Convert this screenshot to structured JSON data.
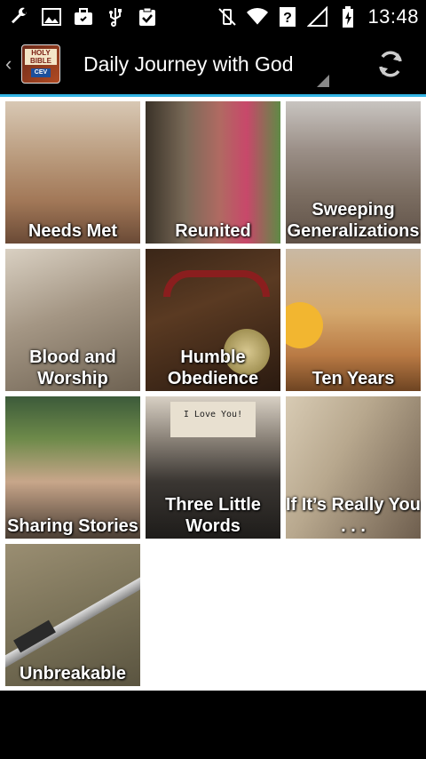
{
  "status_bar": {
    "time": "13:48",
    "left_icons": [
      "wrench-icon",
      "image-icon",
      "briefcase-icon",
      "usb-icon",
      "clipboard-check-icon"
    ],
    "right_icons": [
      "vibrate-off-icon",
      "wifi-icon",
      "question-mark-icon",
      "signal-icon",
      "battery-charging-icon"
    ]
  },
  "action_bar": {
    "title": "Daily Journey with God",
    "logo_text_top": "HOLY BIBLE",
    "logo_text_bottom": "CEV"
  },
  "colors": {
    "accent": "#33b5e5",
    "background": "#ffffff",
    "bar": "#000000"
  },
  "tiles": [
    {
      "label": "Needs Met"
    },
    {
      "label": "Reunited"
    },
    {
      "label": "Sweeping Generalizations"
    },
    {
      "label": "Blood and Worship"
    },
    {
      "label": "Humble Obedience"
    },
    {
      "label": "Ten Years"
    },
    {
      "label": "Sharing Stories"
    },
    {
      "label": "Three Little Words",
      "paper_text": "I Love You!"
    },
    {
      "label": "If It’s Really You . . ."
    },
    {
      "label": "Unbreakable"
    }
  ]
}
